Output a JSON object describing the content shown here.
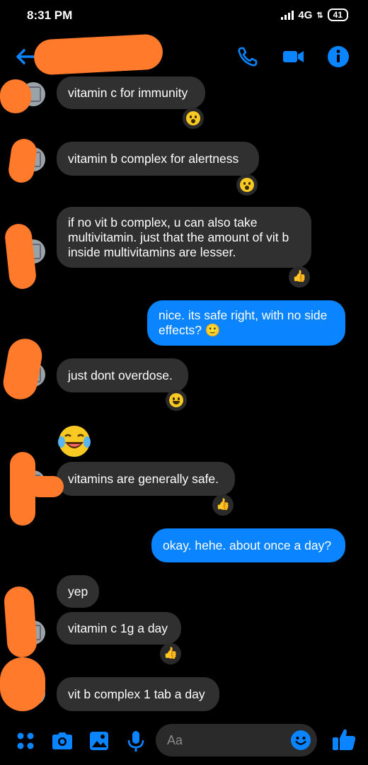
{
  "status_bar": {
    "time": "8:31 PM",
    "network": "4G",
    "battery": "41"
  },
  "header": {
    "contact_name": "",
    "icons": [
      "back-arrow-icon",
      "phone-icon",
      "video-icon",
      "info-icon"
    ]
  },
  "messages": [
    {
      "side": "in",
      "text": "vitamin c for immunity",
      "reaction": "wow"
    },
    {
      "side": "in",
      "text": "vitamin b complex for alertness",
      "reaction": "wow"
    },
    {
      "side": "in",
      "text": "if no vit b complex, u can also take multivitamin. just that the amount of vit b inside multivitamins are lesser.",
      "reaction": "thumbs-up"
    },
    {
      "side": "out",
      "text": "nice. its safe right, with no side effects? 🙂"
    },
    {
      "side": "in",
      "text": "just dont overdose.",
      "reaction": "haha"
    },
    {
      "side": "in",
      "emoji": "laughing-crying-emoji"
    },
    {
      "side": "in",
      "text": "vitamins are generally safe.",
      "reaction": "thumbs-up"
    },
    {
      "side": "out",
      "text": "okay. hehe. about once a day?"
    },
    {
      "side": "in",
      "text": "yep"
    },
    {
      "side": "in",
      "text": "vitamin c 1g a day",
      "reaction": "thumbs-up"
    },
    {
      "side": "in",
      "text": "vit b complex 1 tab a day"
    }
  ],
  "composer": {
    "placeholder": "Aa",
    "icons": [
      "menu-dots-icon",
      "camera-icon",
      "gallery-icon",
      "mic-icon",
      "emoji-icon",
      "like-icon"
    ]
  },
  "colors": {
    "accent": "#0a84ff",
    "incoming_bubble": "#303030",
    "redaction": "#ff7a2b"
  }
}
